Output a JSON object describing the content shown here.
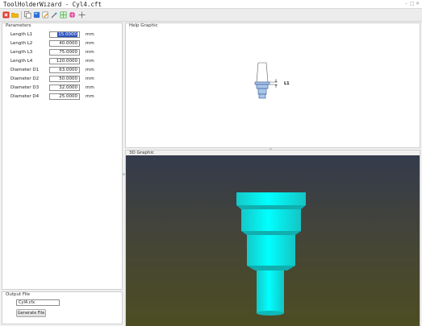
{
  "window": {
    "title": "ToolHolderWizard - Cyl4.cft"
  },
  "panels": {
    "parameters_title": "Parameters",
    "help_title": "Help Graphic",
    "graphic3d_title": "3D Graphic",
    "output_title": "Output File"
  },
  "parameters": [
    {
      "label": "Length L1",
      "value": "15.0000",
      "unit": "mm",
      "selected": true
    },
    {
      "label": "Length L2",
      "value": "40.0000",
      "unit": "mm"
    },
    {
      "label": "Length L3",
      "value": "75.0000",
      "unit": "mm"
    },
    {
      "label": "Length L4",
      "value": "120.0000",
      "unit": "mm"
    },
    {
      "label": "Diameter D1",
      "value": "63.0000",
      "unit": "mm"
    },
    {
      "label": "Diameter D2",
      "value": "50.0000",
      "unit": "mm"
    },
    {
      "label": "Diameter D3",
      "value": "32.0000",
      "unit": "mm"
    },
    {
      "label": "Diameter D4",
      "value": "25.0000",
      "unit": "mm"
    }
  ],
  "help_graphic": {
    "dimension_label": "L1"
  },
  "output": {
    "filename": "Cyl4.cfx",
    "generate_label": "Generate File"
  },
  "colors": {
    "selection": "#2a52be",
    "tool_holder": "#00e5e5",
    "sky_top": "#343b4c",
    "ground": "#4d4d22"
  },
  "toolbar_icons": [
    "close-red-icon",
    "open-folder-icon",
    "copy-icon",
    "book-icon",
    "pencil-icon",
    "magic-wand-icon",
    "grid-icon",
    "globe-icon",
    "crosshair-icon"
  ]
}
